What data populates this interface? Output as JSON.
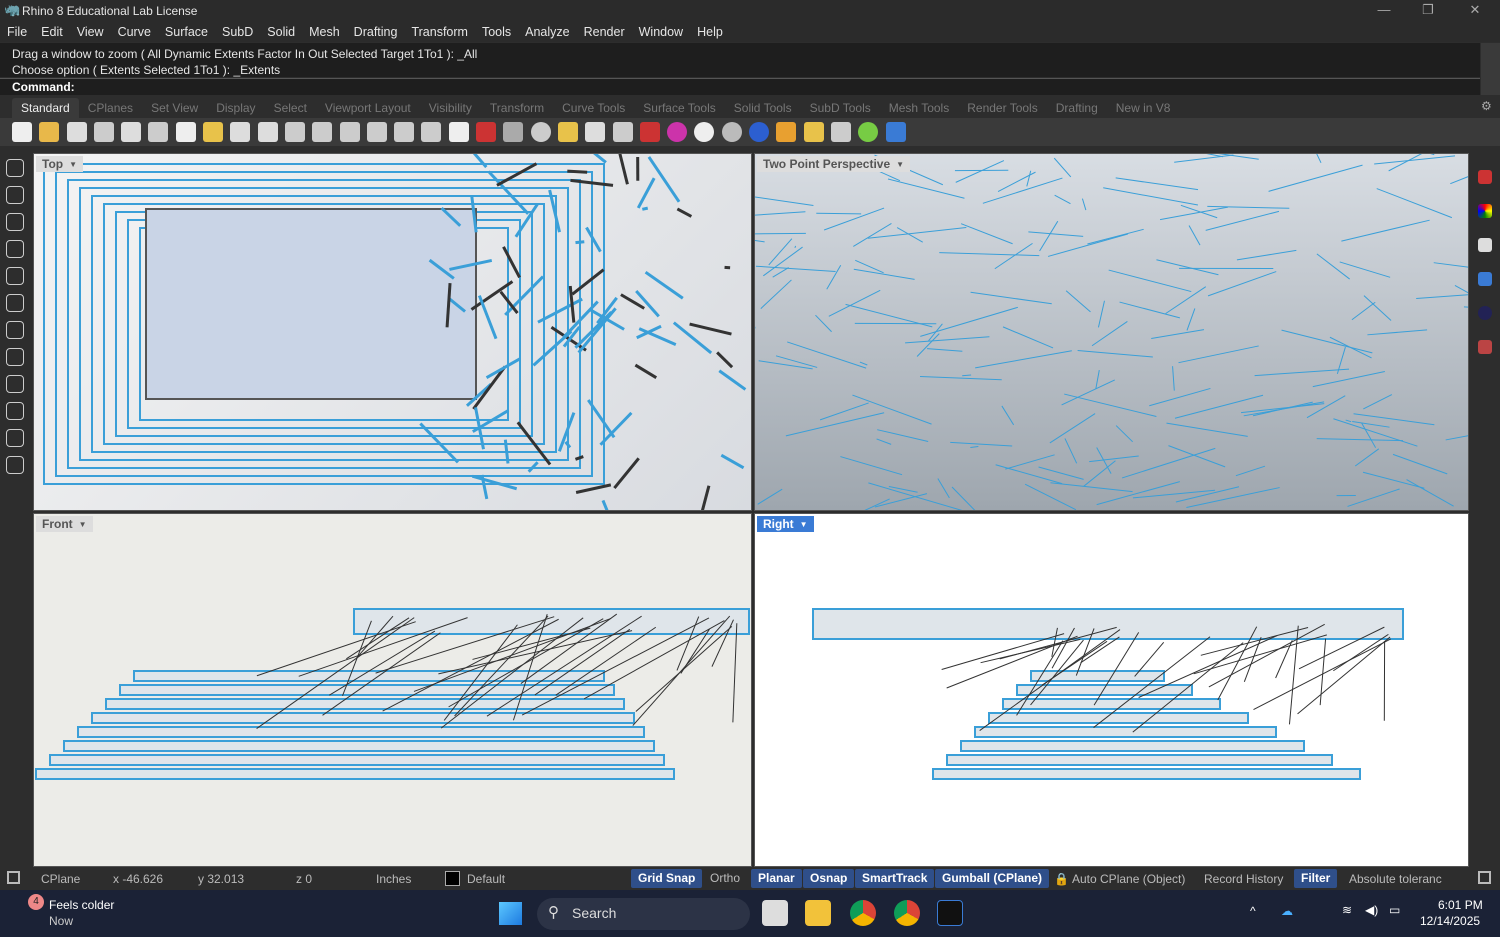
{
  "window": {
    "title": "Rhino 8 Educational Lab License"
  },
  "menu": [
    "File",
    "Edit",
    "View",
    "Curve",
    "Surface",
    "SubD",
    "Solid",
    "Mesh",
    "Drafting",
    "Transform",
    "Tools",
    "Analyze",
    "Render",
    "Window",
    "Help"
  ],
  "command_history": [
    "Drag a window to zoom ( All  Dynamic  Extents  Factor  In  Out  Selected  Target  1To1 ): _All",
    "Choose option ( Extents  Selected  1To1 ): _Extents"
  ],
  "command_prompt": "Command:",
  "toolbar_tabs": [
    "Standard",
    "CPlanes",
    "Set View",
    "Display",
    "Select",
    "Viewport Layout",
    "Visibility",
    "Transform",
    "Curve Tools",
    "Surface Tools",
    "Solid Tools",
    "SubD Tools",
    "Mesh Tools",
    "Render Tools",
    "Drafting",
    "New in V8"
  ],
  "active_tab": "Standard",
  "toolbar_icons": [
    "new-icon",
    "open-icon",
    "save-icon",
    "print-icon",
    "import-icon",
    "cut-icon",
    "copy-icon",
    "paste-icon",
    "undo-icon",
    "pan-icon",
    "rotate-view-icon",
    "zoom-icon",
    "zoom-window-icon",
    "zoom-extents-icon",
    "zoom-selected-icon",
    "undo-view-icon",
    "four-viewports-icon",
    "car-icon",
    "grid-icon",
    "circle-select-icon",
    "points-icon",
    "light-icon",
    "lock-icon",
    "render-icon",
    "color-wheel-icon",
    "sphere-icon",
    "mesh-sphere-icon",
    "blue-sphere-icon",
    "material-icon",
    "sun-icon",
    "dimension-icon",
    "globe-icon",
    "help-icon"
  ],
  "viewports": {
    "top": {
      "label": "Top"
    },
    "perspective": {
      "label": "Two Point Perspective"
    },
    "front": {
      "label": "Front"
    },
    "right": {
      "label": "Right",
      "active": true
    }
  },
  "status": {
    "cplane": "CPlane",
    "x": "x -46.626",
    "y": "y 32.013",
    "z": "z 0",
    "units": "Inches",
    "layer": "Default",
    "grid_snap": "Grid Snap",
    "ortho": "Ortho",
    "planar": "Planar",
    "osnap": "Osnap",
    "smarttrack": "SmartTrack",
    "gumball": "Gumball (CPlane)",
    "auto_cplane": "Auto CPlane (Object)",
    "record_history": "Record History",
    "filter": "Filter",
    "tolerance": "Absolute toleranc"
  },
  "taskbar": {
    "weather_title": "Feels colder",
    "weather_sub": "Now",
    "weather_badge": "4",
    "search_placeholder": "Search",
    "time": "6:01 PM",
    "date": "12/14/2025"
  },
  "colors": {
    "accent": "#3a7bd5",
    "wire": "#3a9fd8",
    "active_status": "#2f4f8a"
  }
}
